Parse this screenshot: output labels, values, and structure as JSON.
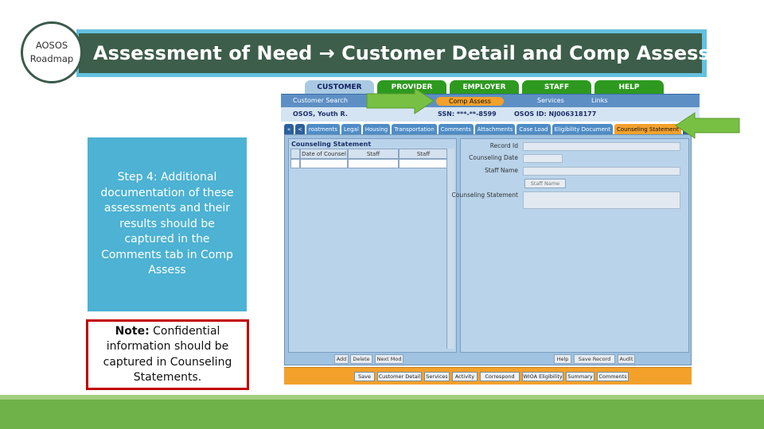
{
  "roadmap": {
    "line1": "AOSOS",
    "line2": "Roadmap"
  },
  "title": {
    "text": "Assessment of Need → Customer Detail and Comp Assess"
  },
  "step_box": {
    "prefix": "Step 4:",
    "text": " Additional documentation of these assessments and their results should be captured in the ",
    "emphasis": "Comments tab in Comp Assess"
  },
  "note_box": {
    "prefix": "Note:",
    "text": " Confidential information should be captured in Counseling Statements."
  },
  "app": {
    "tabs": [
      "CUSTOMER",
      "PROVIDER",
      "EMPLOYER",
      "STAFF",
      "HELP"
    ],
    "nav": [
      "Customer Search",
      "Comp Assess",
      "Services",
      "Links"
    ],
    "info": {
      "name": "OSOS, Youth R.",
      "ssn": "SSN: ***-**-8599",
      "osos_id": "OSOS ID: NJ006318177"
    },
    "subtabs": [
      "«",
      "<",
      "roatments",
      "Legal",
      "Housing",
      "Transportation",
      "Comments",
      "Attachments",
      "Case Load",
      "Eligibility Document",
      "Counseling Statement",
      "»"
    ],
    "left_panel": {
      "title": "Counseling Statement",
      "columns": [
        "Date of Counsel",
        "Staff",
        "Staff"
      ]
    },
    "right_panel": {
      "labels": [
        "Record Id",
        "Counseling Date",
        "Staff Name",
        "Counseling Statement"
      ],
      "staff_button": "Staff Name"
    },
    "left_buttons": [
      "Add",
      "Delete",
      "Next Mod"
    ],
    "right_buttons": [
      "Help",
      "Save Record",
      "Audit"
    ],
    "bottom_buttons": [
      "Save",
      "Customer Detail",
      "Services",
      "Activity",
      "Correspond",
      "WIOA Eligibility",
      "Summary",
      "Comments"
    ]
  },
  "colors": {
    "title_bg": "#3d5e4a",
    "title_border": "#63c0e0",
    "step_bg": "#4db2d3",
    "note_border": "#c00000",
    "green_strip": "#6fb24a",
    "arrow_green": "#77c043"
  }
}
